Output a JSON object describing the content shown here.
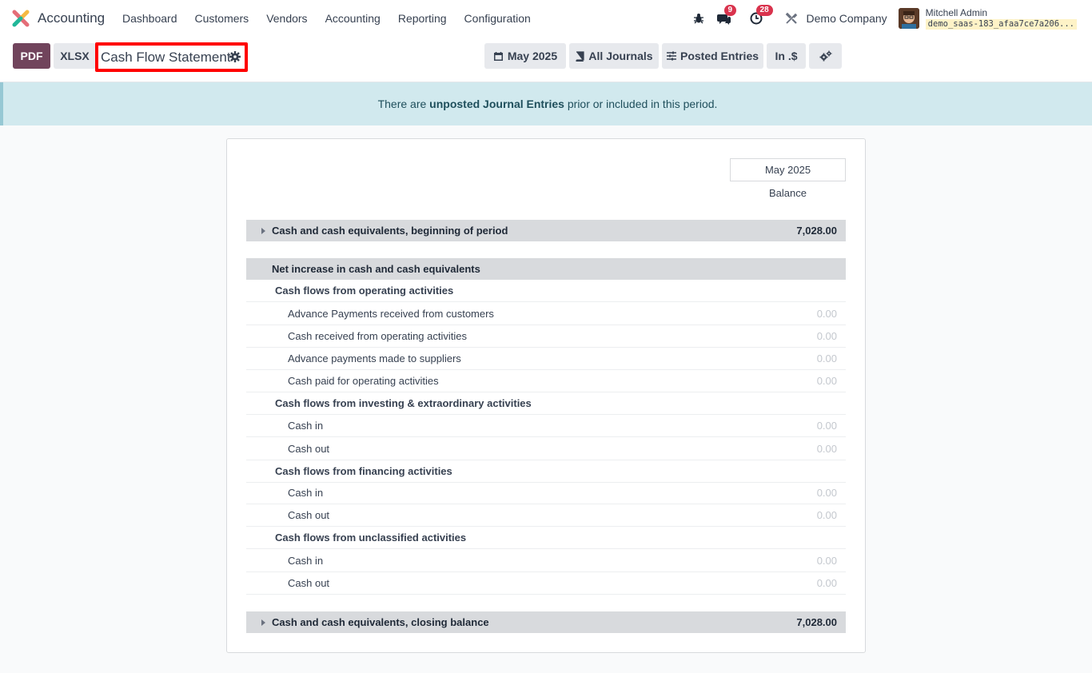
{
  "navbar": {
    "app_name": "Accounting",
    "menu": [
      "Dashboard",
      "Customers",
      "Vendors",
      "Accounting",
      "Reporting",
      "Configuration"
    ],
    "messages_count": "9",
    "activities_count": "28",
    "company": "Demo Company",
    "user_name": "Mitchell Admin",
    "database": "demo_saas-183_afaa7ce7a206..."
  },
  "controls": {
    "pdf_label": "PDF",
    "xlsx_label": "XLSX",
    "report_title": "Cash Flow Statement",
    "date_filter": "May 2025",
    "journals_filter": "All Journals",
    "entries_filter": "Posted Entries",
    "currency_filter": "In .$"
  },
  "alert": {
    "before": "There are ",
    "bold": "unposted Journal Entries",
    "after": " prior or included in this period."
  },
  "report": {
    "column_header": "May 2025",
    "column_sub": "Balance",
    "rows": [
      {
        "type": "section",
        "label": "Cash and cash equivalents, beginning of period",
        "value": "7,028.00",
        "caret": true
      },
      {
        "type": "section",
        "label": "Net increase in cash and cash equivalents",
        "value": "",
        "caret": false
      },
      {
        "type": "sub",
        "label": "Cash flows from operating activities",
        "value": ""
      },
      {
        "type": "line",
        "label": "Advance Payments received from customers",
        "value": "0.00"
      },
      {
        "type": "line",
        "label": "Cash received from operating activities",
        "value": "0.00"
      },
      {
        "type": "line",
        "label": "Advance payments made to suppliers",
        "value": "0.00"
      },
      {
        "type": "line",
        "label": "Cash paid for operating activities",
        "value": "0.00"
      },
      {
        "type": "sub",
        "label": "Cash flows from investing & extraordinary activities",
        "value": ""
      },
      {
        "type": "line",
        "label": "Cash in",
        "value": "0.00"
      },
      {
        "type": "line",
        "label": "Cash out",
        "value": "0.00"
      },
      {
        "type": "sub",
        "label": "Cash flows from financing activities",
        "value": ""
      },
      {
        "type": "line",
        "label": "Cash in",
        "value": "0.00"
      },
      {
        "type": "line",
        "label": "Cash out",
        "value": "0.00"
      },
      {
        "type": "sub",
        "label": "Cash flows from unclassified activities",
        "value": ""
      },
      {
        "type": "line",
        "label": "Cash in",
        "value": "0.00"
      },
      {
        "type": "line",
        "label": "Cash out",
        "value": "0.00"
      },
      {
        "type": "section",
        "label": "Cash and cash equivalents, closing balance",
        "value": "7,028.00",
        "caret": true
      }
    ]
  }
}
